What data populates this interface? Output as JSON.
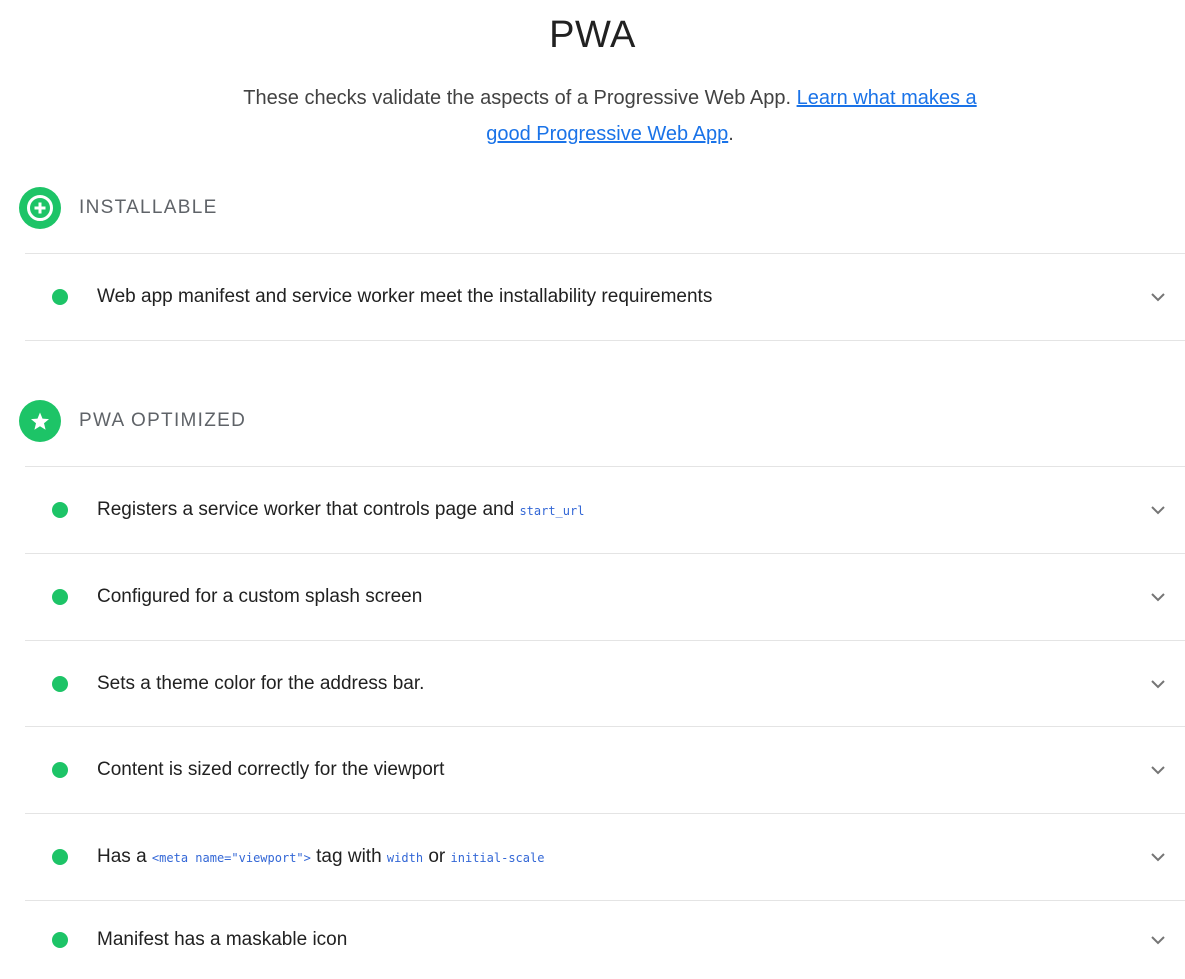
{
  "category": {
    "title": "PWA",
    "description_prefix": "These checks validate the aspects of a Progressive Web App.",
    "description_link": "Learn what makes a good Progressive Web App",
    "description_suffix": "."
  },
  "groups": {
    "installable": {
      "title": "INSTALLABLE",
      "icon": "plus-circle-icon",
      "audits": [
        {
          "title": "Web app manifest and service worker meet the installability requirements",
          "status": "pass"
        }
      ]
    },
    "optimized": {
      "title": "PWA OPTIMIZED",
      "icon": "star-icon",
      "audits": [
        {
          "title": "Registers a service worker that controls page and",
          "code": "start_url",
          "status": "pass"
        },
        {
          "title": "Configured for a custom splash screen",
          "status": "pass"
        },
        {
          "title": "Sets a theme color for the address bar.",
          "status": "pass"
        },
        {
          "title": "Content is sized correctly for the viewport",
          "status": "pass"
        },
        {
          "title_prefix": "Has a",
          "code_1": "<meta name=\"viewport\">",
          "title_middle": "tag with",
          "code_2": "width",
          "title_or": "or",
          "code_3": "initial-scale",
          "status": "pass"
        },
        {
          "title": "Manifest has a maskable icon",
          "status": "pass"
        }
      ]
    }
  },
  "colors": {
    "pass": "#1dc467",
    "link": "#1a73e8",
    "code": "#3367d6"
  }
}
